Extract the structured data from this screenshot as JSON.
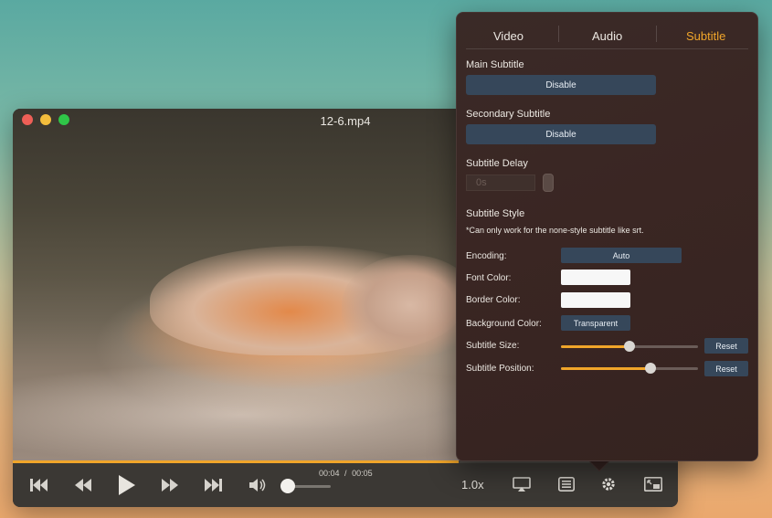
{
  "window": {
    "title": "12-6.mp4",
    "close_color": "#ee5f57",
    "minimize_color": "#f3bd3c",
    "maximize_color": "#2fc648"
  },
  "playback": {
    "position": "00:04",
    "separator": "/",
    "duration": "00:05",
    "progress": 0.67,
    "volume": 0.1,
    "speed": "1.0x"
  },
  "controls": {
    "icons": [
      "skip-back-icon",
      "rewind-icon",
      "play-icon",
      "fast-forward-icon",
      "skip-forward-icon",
      "volume-icon",
      "airplay-icon",
      "playlist-icon",
      "settings-icon",
      "picture-in-picture-icon"
    ]
  },
  "panel": {
    "tabs": [
      {
        "label": "Video",
        "active": false
      },
      {
        "label": "Audio",
        "active": false
      },
      {
        "label": "Subtitle",
        "active": true
      }
    ],
    "main_subtitle": {
      "label": "Main Subtitle",
      "value": "Disable"
    },
    "secondary_subtitle": {
      "label": "Secondary Subtitle",
      "value": "Disable"
    },
    "subtitle_delay": {
      "label": "Subtitle Delay",
      "value": "0s"
    },
    "subtitle_style": {
      "label": "Subtitle Style",
      "note": "*Can only work for the none-style subtitle like srt.",
      "encoding": {
        "label": "Encoding:",
        "value": "Auto"
      },
      "font_color": {
        "label": "Font Color:",
        "color": "#f7f7f7"
      },
      "border_color": {
        "label": "Border Color:",
        "color": "#f7f7f7"
      },
      "background_color": {
        "label": "Background Color:",
        "value": "Transparent"
      },
      "subtitle_size": {
        "label": "Subtitle Size:",
        "level": 0.5,
        "reset": "Reset"
      },
      "subtitle_position": {
        "label": "Subtitle Position:",
        "level": 0.65,
        "reset": "Reset"
      }
    }
  },
  "colors": {
    "accent": "#f0a52a",
    "button_bg": "#36475a"
  }
}
